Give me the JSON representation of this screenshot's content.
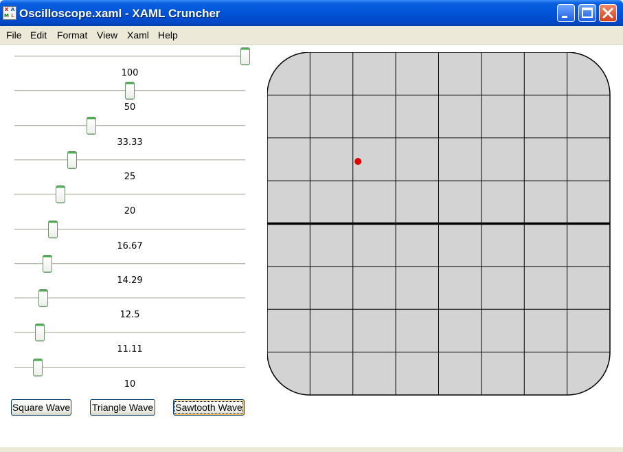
{
  "window": {
    "title": "Oscilloscope.xaml - XAML Cruncher",
    "icon": "xaml-cruncher-app-icon",
    "icon_letters": [
      "X",
      "A",
      "M",
      "L"
    ]
  },
  "menu": [
    "File",
    "Edit",
    "Format",
    "View",
    "Xaml",
    "Help"
  ],
  "sliders": [
    {
      "label": "100",
      "value": 100
    },
    {
      "label": "50",
      "value": 50
    },
    {
      "label": "33.33",
      "value": 33.33
    },
    {
      "label": "25",
      "value": 25
    },
    {
      "label": "20",
      "value": 20
    },
    {
      "label": "16.67",
      "value": 16.67
    },
    {
      "label": "14.29",
      "value": 14.29
    },
    {
      "label": "12.5",
      "value": 12.5
    },
    {
      "label": "11.11",
      "value": 11.11
    },
    {
      "label": "10",
      "value": 10
    }
  ],
  "slider_range": [
    0,
    100
  ],
  "buttons": {
    "square": "Square Wave",
    "triangle": "Triangle Wave",
    "sawtooth": "Sawtooth Wave"
  },
  "scope": {
    "grid_columns": 8,
    "grid_rows": 8,
    "background": "#d3d3d3",
    "trace_color": "#e00000",
    "dot_position": {
      "x": 2.12,
      "y": 2.55
    }
  },
  "colors": {
    "titlebar": "#0054e3",
    "menu_bg": "#ece9d8",
    "slider_thumb_accent": "#4caf50"
  }
}
